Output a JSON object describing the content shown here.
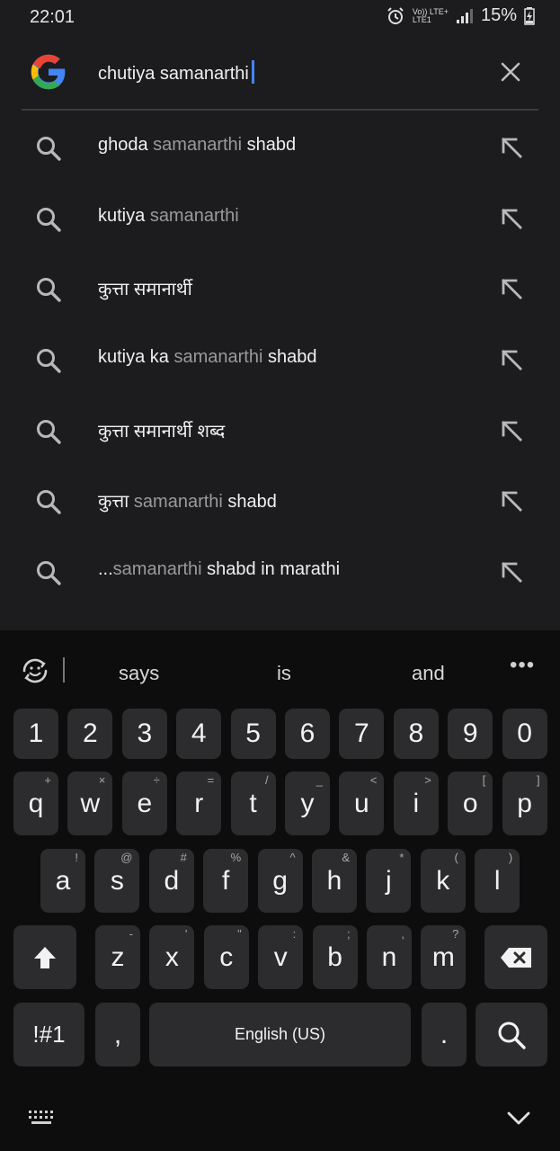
{
  "status": {
    "time": "22:01",
    "network_top": "Vo)) LTE+",
    "network_bottom": "LTE1",
    "battery": "15%"
  },
  "search": {
    "query": "chutiya samanarthi",
    "icon": "google-logo",
    "clear_icon": "close-icon"
  },
  "suggestions": [
    {
      "parts": [
        {
          "t": "ghoda ",
          "dim": false
        },
        {
          "t": "samanarthi",
          "dim": true
        },
        {
          "t": " shabd",
          "dim": false
        }
      ]
    },
    {
      "parts": [
        {
          "t": "kutiya ",
          "dim": false
        },
        {
          "t": "samanarthi",
          "dim": true
        }
      ]
    },
    {
      "parts": [
        {
          "t": "कुत्ता समानार्थी",
          "dim": false
        }
      ]
    },
    {
      "parts": [
        {
          "t": "kutiya ka ",
          "dim": false
        },
        {
          "t": "samanarthi",
          "dim": true
        },
        {
          "t": " shabd",
          "dim": false
        }
      ]
    },
    {
      "parts": [
        {
          "t": "कुत्ता समानार्थी शब्द",
          "dim": false
        }
      ]
    },
    {
      "parts": [
        {
          "t": "कुत्ता ",
          "dim": false
        },
        {
          "t": "samanarthi",
          "dim": true
        },
        {
          "t": " shabd",
          "dim": false
        }
      ]
    },
    {
      "parts": [
        {
          "t": "...",
          "dim": false
        },
        {
          "t": "samanarthi",
          "dim": true
        },
        {
          "t": " shabd in marathi",
          "dim": false
        }
      ]
    }
  ],
  "keyboard": {
    "predictions": [
      "says",
      "is",
      "and"
    ],
    "more_label": "•••",
    "number_row": [
      "1",
      "2",
      "3",
      "4",
      "5",
      "6",
      "7",
      "8",
      "9",
      "0"
    ],
    "row1": [
      {
        "k": "q",
        "s": "+"
      },
      {
        "k": "w",
        "s": "×"
      },
      {
        "k": "e",
        "s": "÷"
      },
      {
        "k": "r",
        "s": "="
      },
      {
        "k": "t",
        "s": "/"
      },
      {
        "k": "y",
        "s": "_"
      },
      {
        "k": "u",
        "s": "<"
      },
      {
        "k": "i",
        "s": ">"
      },
      {
        "k": "o",
        "s": "["
      },
      {
        "k": "p",
        "s": "]"
      }
    ],
    "row2": [
      {
        "k": "a",
        "s": "!"
      },
      {
        "k": "s",
        "s": "@"
      },
      {
        "k": "d",
        "s": "#"
      },
      {
        "k": "f",
        "s": "%"
      },
      {
        "k": "g",
        "s": "^"
      },
      {
        "k": "h",
        "s": "&"
      },
      {
        "k": "j",
        "s": "*"
      },
      {
        "k": "k",
        "s": "("
      },
      {
        "k": "l",
        "s": ")"
      }
    ],
    "row3": [
      {
        "k": "z",
        "s": "-"
      },
      {
        "k": "x",
        "s": "'"
      },
      {
        "k": "c",
        "s": "\""
      },
      {
        "k": "v",
        "s": ":"
      },
      {
        "k": "b",
        "s": ";"
      },
      {
        "k": "n",
        "s": ","
      },
      {
        "k": "m",
        "s": "?"
      }
    ],
    "symbols_label": "!#1",
    "comma_label": ",",
    "space_label": "English (US)",
    "period_label": ".",
    "icons": {
      "shift": "shift-icon",
      "backspace": "backspace-icon",
      "search": "search-icon"
    }
  }
}
